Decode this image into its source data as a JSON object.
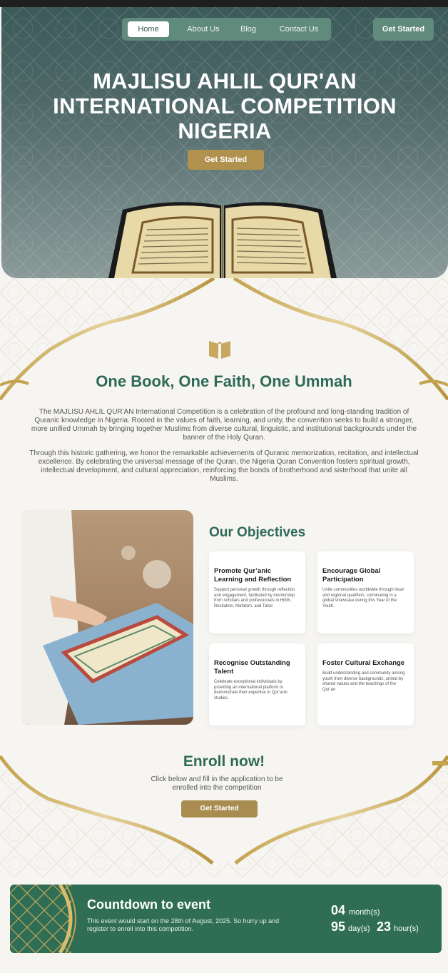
{
  "nav": {
    "items": [
      "Home",
      "About Us",
      "Blog",
      "Contact Us"
    ],
    "cta": "Get Started"
  },
  "hero": {
    "title_line1": "MAJLISU AHLIL QUR'AN",
    "title_line2": "INTERNATIONAL COMPETITION",
    "title_line3": "NIGERIA",
    "cta": "Get Started"
  },
  "about": {
    "title": "One Book, One Faith, One Ummah",
    "paragraph1": "The MAJLISU AHLIL QUR'AN International Competition is a celebration of the profound and long-standing tradition of Quranic knowledge in Nigeria. Rooted in the values of faith, learning, and  unity, the convention seeks to build a stronger, more unified Ummah by  bringing together Muslims from diverse cultural, linguistic, and institutional backgrounds under the banner of the Holy Quran.",
    "paragraph2": "Through this historic gathering, we honor the remarkable achievements of  Quranic memorization, recitation, and intellectual excellence. By  celebrating the universal message of the Quran, the Nigeria Quran  Convention fosters spiritual growth, intellectual development, and  cultural appreciation, reinforcing the bonds of brotherhood and sisterhood that unite all Muslims."
  },
  "objectives": {
    "title": "Our Objectives",
    "cards": [
      {
        "title": "Promote Qur’anic Learning and Reflection",
        "text": "Support personal growth through reflection and engagement, facilitated by mentorship from scholars and professionals in Hifdh, Recitation, Mafahim, and Tafsir."
      },
      {
        "title": "Encourage Global Participation",
        "text": "Unite communities worldwide through local and regional qualifiers, culminating in a global showcase during this Year of the Youth."
      },
      {
        "title": "Recognise Outstanding Talent",
        "text": "Celebrate exceptional individuals by providing an international platform to demonstrate their expertise in Qur’anic studies."
      },
      {
        "title": "Foster Cultural Exchange",
        "text": "Build understanding and community among youth from diverse backgrounds, united by shared values and the teachings of the Qur’an."
      }
    ]
  },
  "enroll": {
    "title": "Enroll now!",
    "text": "Click below and fill in the application to be enrolled into the competition",
    "cta": "Get Started"
  },
  "countdown": {
    "title": "Countdown to event",
    "text": "This event would start on the 28th of August, 2025. So hurry up and register to enroll into this competition.",
    "months": "04",
    "months_unit": "month(s)",
    "days": "95",
    "days_unit": "day(s)",
    "hours": "23",
    "hours_unit": "hour(s)"
  },
  "colors": {
    "primary_green": "#2e6a57",
    "gold": "#b0924e",
    "nav_green": "#5f8a7c"
  }
}
